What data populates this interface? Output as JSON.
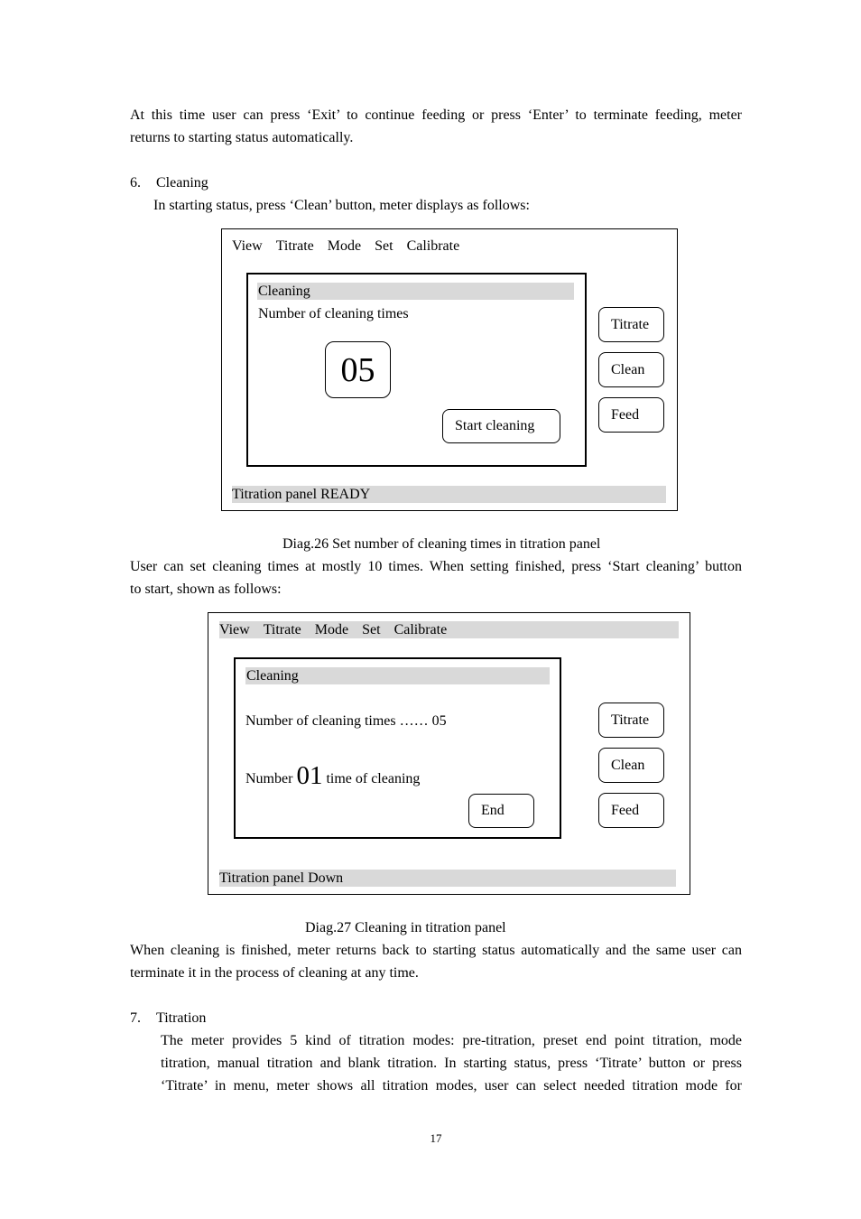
{
  "intro_paragraph": {
    "lines": [
      "At this time user can press ‘Exit’ to continue feeding or press ‘Enter’ to terminate feeding, meter",
      "returns to starting status automatically."
    ]
  },
  "section_6": {
    "number": "6.",
    "title": "Cleaning",
    "intro": "In starting status, press ‘Clean’ button, meter displays as follows:"
  },
  "diag26": {
    "menu": [
      "View",
      "Titrate",
      "Mode",
      "Set",
      "Calibrate"
    ],
    "dialog_title": "Cleaning",
    "label": "Number of cleaning times",
    "value": "05",
    "start_button": "Start cleaning",
    "side_buttons": [
      "Titrate",
      "Clean",
      "Feed"
    ],
    "status": "Titration panel READY",
    "caption": "Diag.26 Set number of cleaning times in titration panel"
  },
  "after_diag26": {
    "lines": [
      "User can set cleaning times at mostly 10 times. When setting finished, press ‘Start cleaning’ button",
      "to start, shown as follows:"
    ]
  },
  "diag27": {
    "menu": [
      "View",
      "Titrate",
      "Mode",
      "Set",
      "Calibrate"
    ],
    "dialog_title": "Cleaning",
    "times_line": "Number of cleaning times …… 05",
    "progress_prefix": "Number",
    "progress_value": "01",
    "progress_suffix": "time of cleaning",
    "end_button": "End",
    "side_buttons": [
      "Titrate",
      "Clean",
      "Feed"
    ],
    "status": "Titration panel Down",
    "caption": "Diag.27 Cleaning in titration panel"
  },
  "after_diag27": {
    "lines": [
      "When cleaning is finished, meter returns back to starting status automatically and the same user can",
      "terminate it in the process of cleaning at any time."
    ]
  },
  "section_7": {
    "number": "7.",
    "title": "Titration",
    "lines": [
      "The meter provides 5 kind of titration modes: pre-titration, preset end point titration, mode",
      "titration, manual titration and blank titration. In starting status, press ‘Titrate’ button or press",
      "‘Titrate’ in menu, meter shows all titration modes, user can select needed titration mode for"
    ]
  },
  "page_number": "17"
}
